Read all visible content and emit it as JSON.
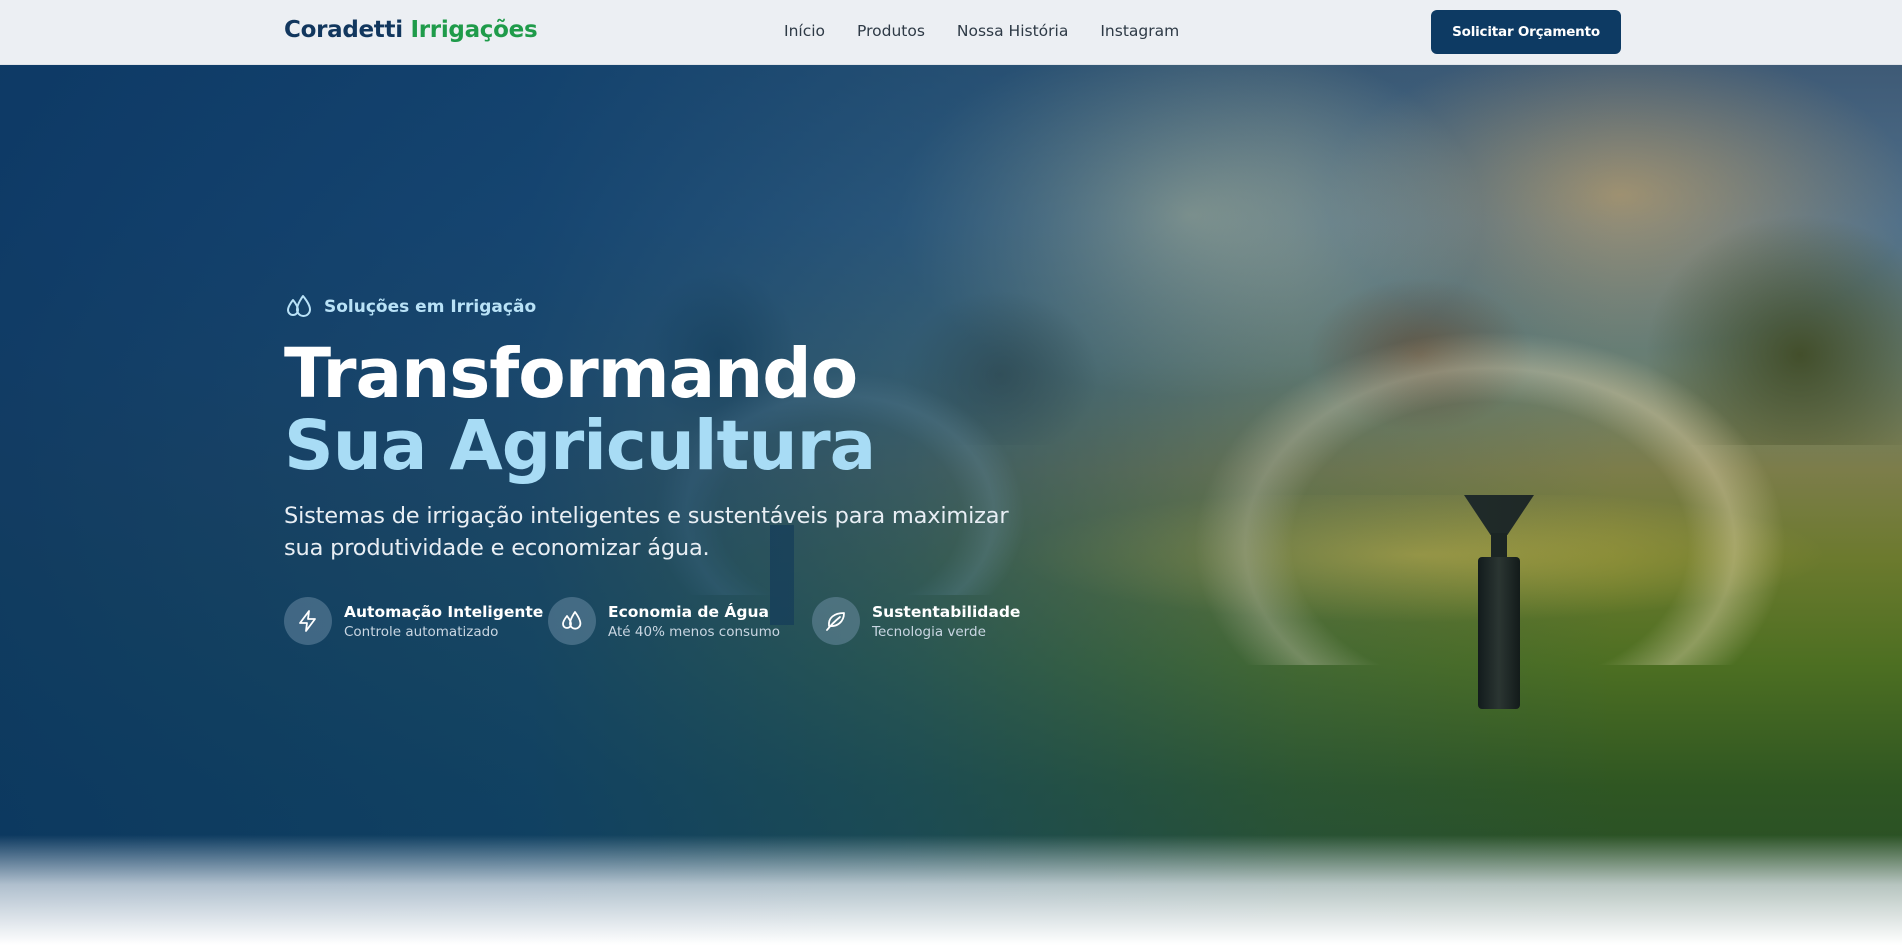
{
  "header": {
    "logo_part1": "Coradetti",
    "logo_part2": "Irrigações",
    "nav": [
      {
        "label": "Início"
      },
      {
        "label": "Produtos"
      },
      {
        "label": "Nossa História"
      },
      {
        "label": "Instagram"
      }
    ],
    "cta_label": "Solicitar Orçamento"
  },
  "hero": {
    "kicker_icon": "droplets-icon",
    "kicker": "Soluções em Irrigação",
    "title_line1": "Transformando",
    "title_line2": "Sua Agricultura",
    "subtitle": "Sistemas de irrigação inteligentes e sustentáveis para maximizar sua produtividade e economizar água.",
    "features": [
      {
        "icon": "lightning-icon",
        "title": "Automação Inteligente",
        "desc": "Controle automatizado"
      },
      {
        "icon": "droplets-icon",
        "title": "Economia de Água",
        "desc": "Até 40% menos consumo"
      },
      {
        "icon": "leaf-icon",
        "title": "Sustentabilidade",
        "desc": "Tecnologia verde"
      }
    ]
  },
  "colors": {
    "brand_navy": "#12375e",
    "brand_green": "#1f9b4a",
    "cta_background": "#0d3a63",
    "title_accent": "#a8dcf5"
  }
}
